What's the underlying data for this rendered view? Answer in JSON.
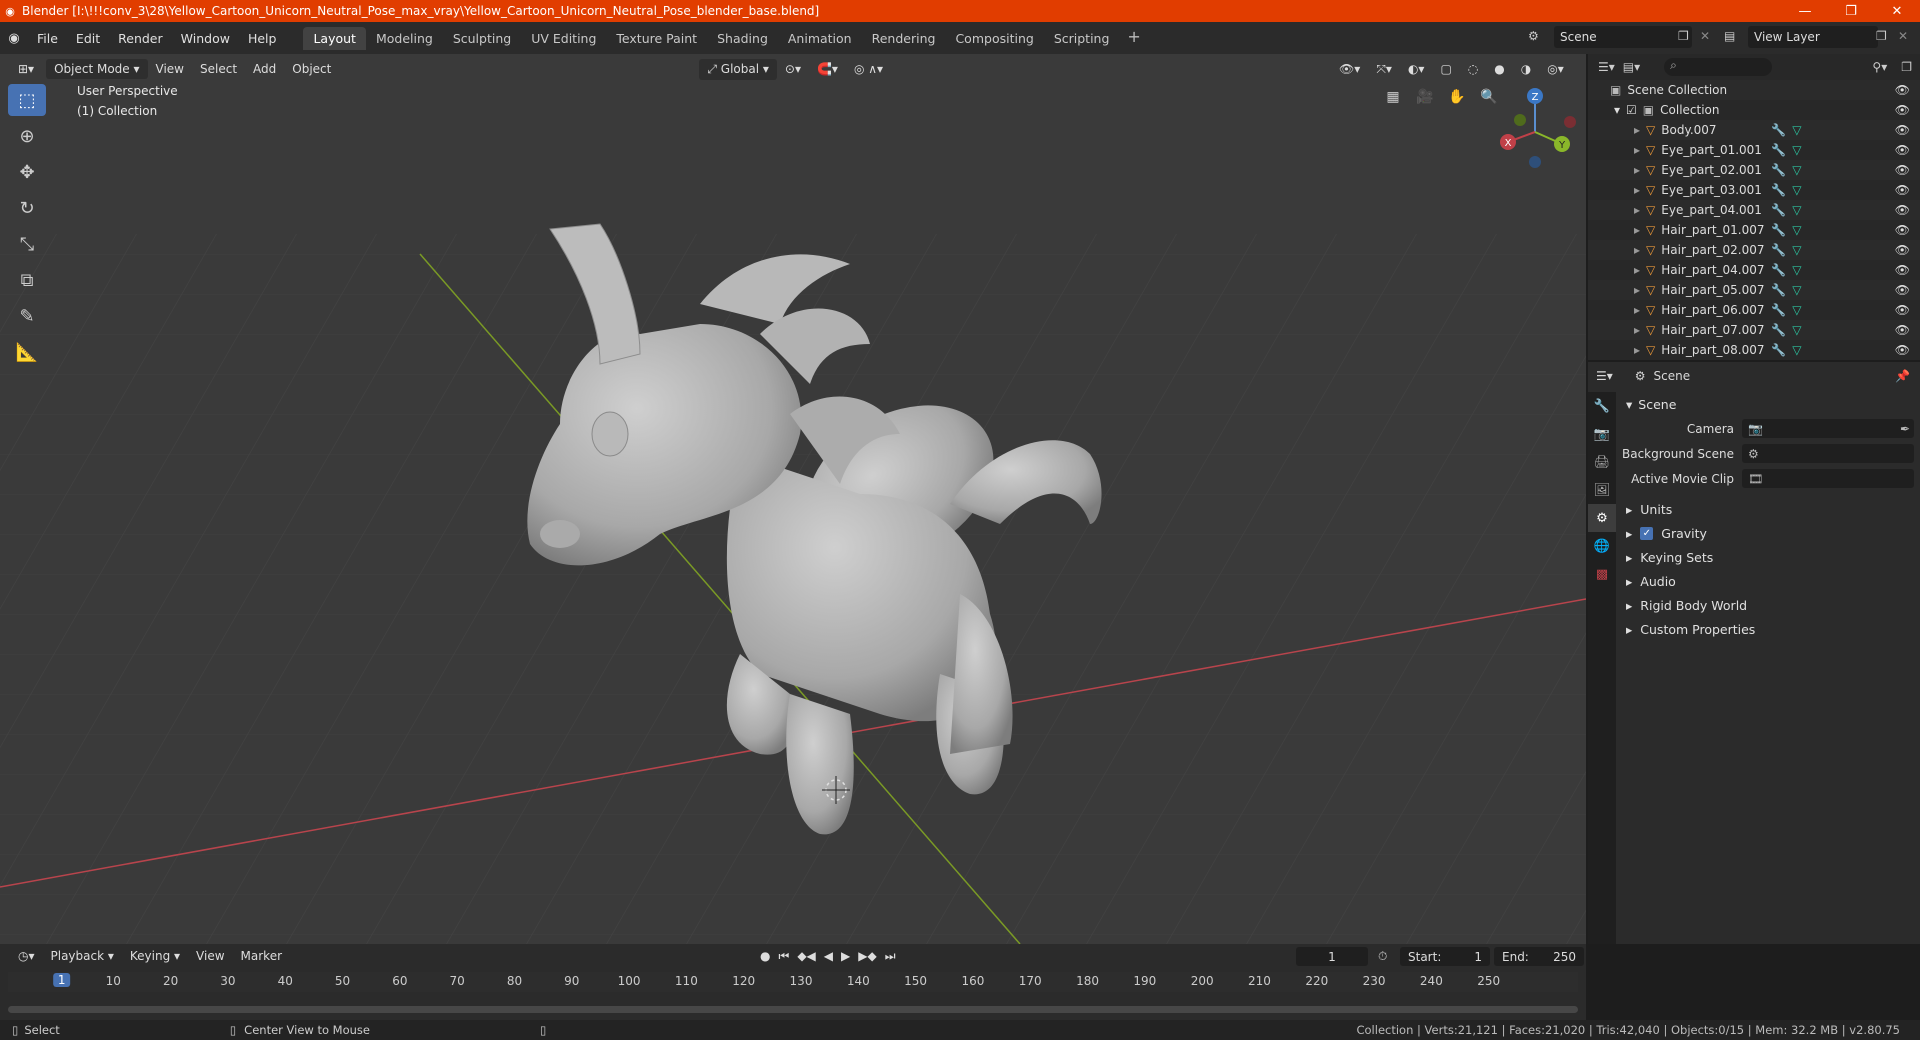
{
  "window": {
    "title": "Blender [I:\\!!!conv_3\\28\\Yellow_Cartoon_Unicorn_Neutral_Pose_max_vray\\Yellow_Cartoon_Unicorn_Neutral_Pose_blender_base.blend]",
    "min": "—",
    "restore": "❐",
    "close": "✕"
  },
  "menu": [
    "File",
    "Edit",
    "Render",
    "Window",
    "Help"
  ],
  "workspaces": [
    "Layout",
    "Modeling",
    "Sculpting",
    "UV Editing",
    "Texture Paint",
    "Shading",
    "Animation",
    "Rendering",
    "Compositing",
    "Scripting"
  ],
  "scene_name": "Scene",
  "view_layer": "View Layer",
  "viewport": {
    "mode": "Object Mode",
    "menus": [
      "View",
      "Select",
      "Add",
      "Object"
    ],
    "transform": "Global",
    "perspective": "User Perspective",
    "collection": "(1) Collection",
    "gizmo": {
      "x": "X",
      "y": "Y",
      "z": "Z"
    }
  },
  "outliner": {
    "root": "Scene Collection",
    "collection": "Collection",
    "items": [
      "Body.007",
      "Eye_part_01.001",
      "Eye_part_02.001",
      "Eye_part_03.001",
      "Eye_part_04.001",
      "Hair_part_01.007",
      "Hair_part_02.007",
      "Hair_part_04.007",
      "Hair_part_05.007",
      "Hair_part_06.007",
      "Hair_part_07.007",
      "Hair_part_08.007"
    ]
  },
  "properties": {
    "header": "Scene",
    "section": "Scene",
    "camera_label": "Camera",
    "bg_scene_label": "Background Scene",
    "movie_clip_label": "Active Movie Clip",
    "sections": [
      "Units",
      "Gravity",
      "Keying Sets",
      "Audio",
      "Rigid Body World",
      "Custom Properties"
    ]
  },
  "timeline": {
    "menus": [
      "Playback",
      "Keying",
      "View",
      "Marker"
    ],
    "current": "1",
    "start_label": "Start:",
    "start": "1",
    "end_label": "End:",
    "end": "250",
    "ticks": [
      "10",
      "20",
      "30",
      "40",
      "50",
      "60",
      "70",
      "80",
      "90",
      "100",
      "110",
      "120",
      "130",
      "140",
      "150",
      "160",
      "170",
      "180",
      "190",
      "200",
      "210",
      "220",
      "230",
      "240",
      "250"
    ],
    "cursor": "1"
  },
  "status": {
    "select": "Select",
    "center": "Center View to Mouse",
    "stats": "Collection | Verts:21,121 | Faces:21,020 | Tris:42,040 | Objects:0/15 | Mem: 32.2 MB | v2.80.75"
  },
  "colors": {
    "accent": "#4772b3",
    "titlebar": "#e13d00",
    "axis_x": "#c04048",
    "axis_y": "#7a9a25"
  }
}
